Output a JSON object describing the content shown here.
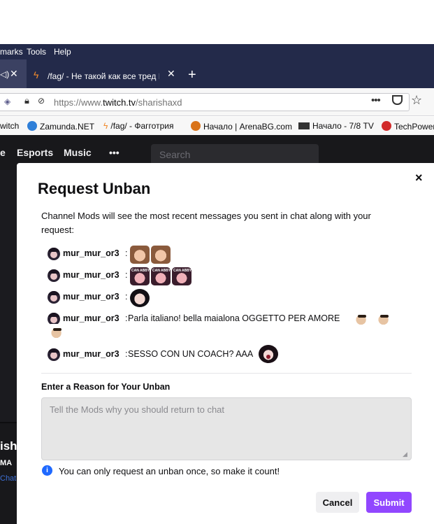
{
  "browser": {
    "menu": [
      "marks",
      "Tools",
      "Help"
    ],
    "tabs": [
      {
        "title": "",
        "active": true
      },
      {
        "title": "/fag/ - Не такой как все тред №",
        "active": false
      }
    ],
    "url_prefix": "https://www.",
    "url_domain": "twitch.tv",
    "url_path": "/sharishaxd",
    "bookmarks": [
      "witch",
      "Zamunda.NET",
      "/fag/ - Фагготрия",
      "Начало | ArenaBG.com",
      "Начало - 7/8 TV",
      "TechPower"
    ]
  },
  "twitch": {
    "nav": [
      "e",
      "Esports",
      "Music",
      "•••"
    ],
    "search_placeholder": "Search",
    "side_name": "ish",
    "side_ma": "MA",
    "side_chat": "Chat"
  },
  "modal": {
    "close_label": "×",
    "title": "Request Unban",
    "intro": "Channel Mods will see the most recent messages you sent in chat along with your request:",
    "messages": [
      {
        "user": "mur_mur_or3",
        "text": ""
      },
      {
        "user": "mur_mur_or3",
        "text": ""
      },
      {
        "user": "mur_mur_or3",
        "text": ""
      },
      {
        "user": "mur_mur_or3",
        "text": "Parla italiano! bella maialona OGGETTO PER AMORE"
      },
      {
        "user": "mur_mur_or3",
        "text": "SESSO CON UN COACH? AAA"
      }
    ],
    "reason_label": "Enter a Reason for Your Unban",
    "reason_placeholder": "Tell the Mods why you should return to chat",
    "reason_value": "",
    "notice_icon": "info-icon",
    "notice": "You can only request an unban once, so make it count!",
    "cancel_label": "Cancel",
    "submit_label": "Submit",
    "accent_color": "#9147ff"
  }
}
